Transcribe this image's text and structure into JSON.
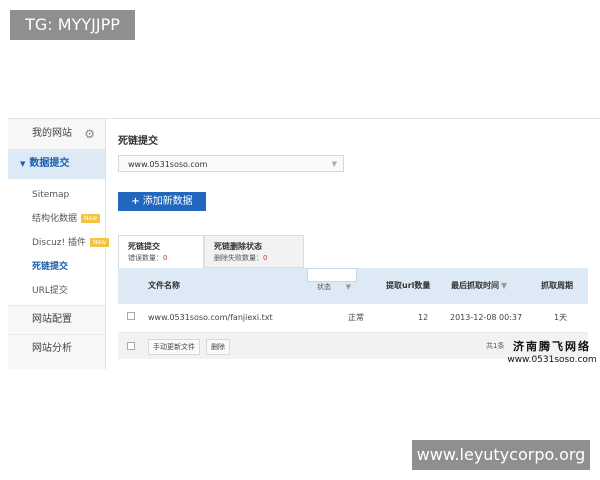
{
  "watermarks": {
    "top": "TG: MYYJJPP",
    "bottom": "www.leyutycorpo.org"
  },
  "sidebar": {
    "header": "我的网站",
    "header_icon": "gear-icon",
    "active_section": "数据提交",
    "sub_items": [
      {
        "label": "Sitemap",
        "badge": ""
      },
      {
        "label": "结构化数据",
        "badge": "New"
      },
      {
        "label": "Discuz! 插件",
        "badge": "New"
      },
      {
        "label": "死链提交",
        "badge": ""
      },
      {
        "label": "URL提交",
        "badge": ""
      }
    ],
    "current_item": "死链提交",
    "sections": [
      "网站配置",
      "网站分析"
    ]
  },
  "main": {
    "title": "死链提交",
    "site_select": "www.0531soso.com",
    "add_button": "添加新数据",
    "tabs": [
      {
        "title": "死链提交",
        "sub_label": "错误数量：",
        "sub_value": "0"
      },
      {
        "title": "死链删除状态",
        "sub_label": "删除失败数量：",
        "sub_value": "0"
      }
    ],
    "table": {
      "headers": {
        "file_name": "文件名称",
        "status": "状态",
        "url_count": "提取url数量",
        "last_fetch": "最后抓取时间",
        "fetch_cycle": "抓取周期"
      },
      "rows": [
        {
          "file": "www.0531soso.com/fanjiexi.txt",
          "status": "正常",
          "count": "12",
          "time": "2013-12-08 00:37",
          "cycle": "1天"
        }
      ],
      "footer": {
        "update_button": "手动更新文件",
        "delete_button": "删除",
        "pagination": "共1条"
      }
    }
  },
  "stamp": {
    "line1": "济南腾飞网络",
    "line2": "www.0531soso.com"
  },
  "colors": {
    "accent": "#2067bd",
    "active_bg": "#dde9f5",
    "badge": "#f5c242"
  }
}
